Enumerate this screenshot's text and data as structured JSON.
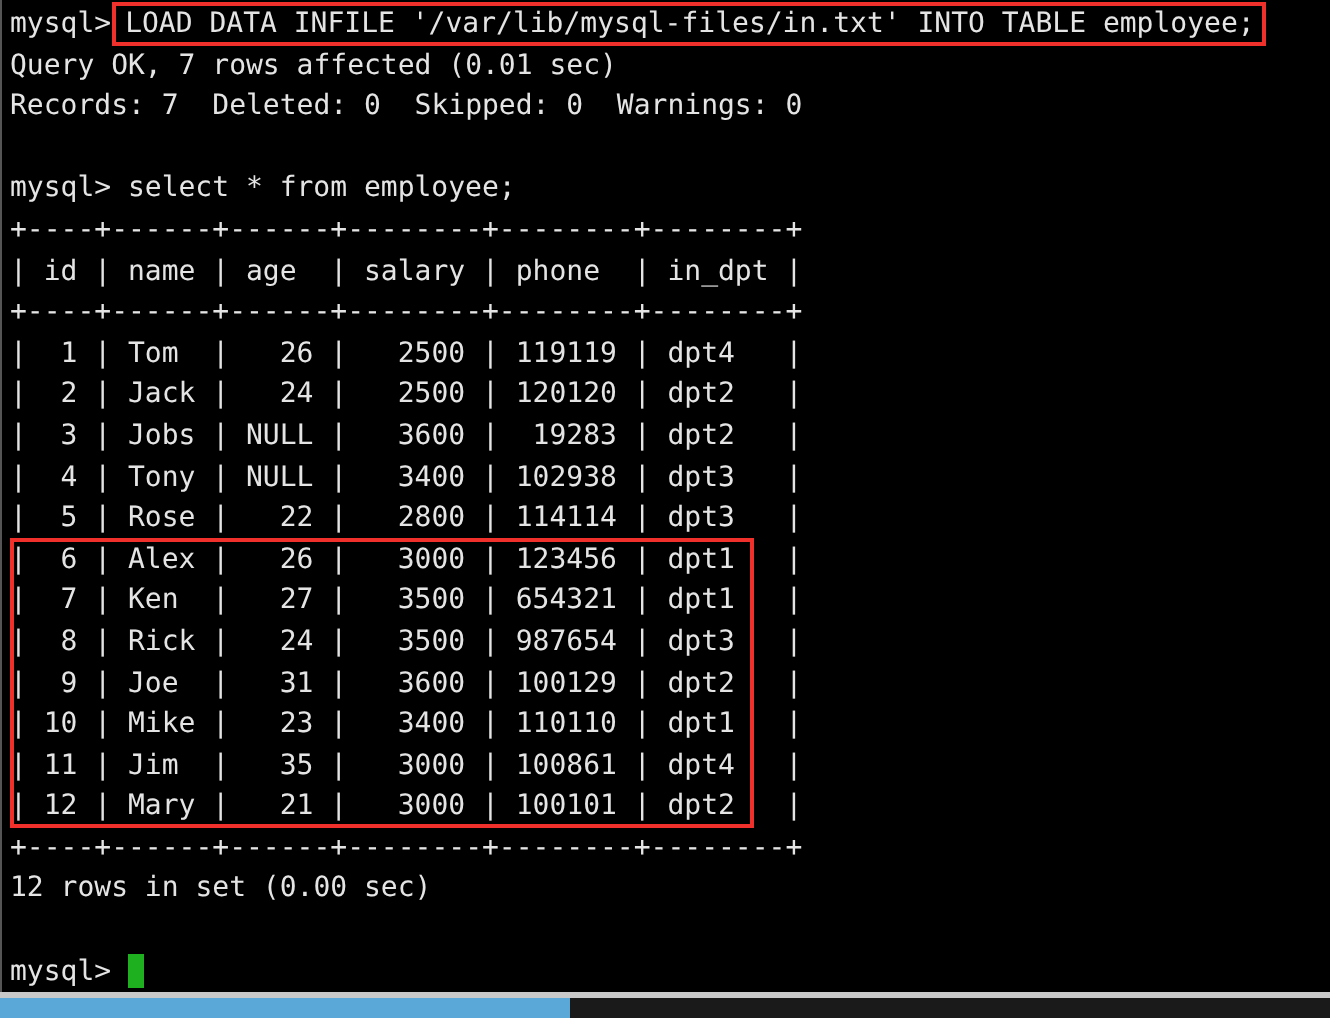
{
  "terminal": {
    "lines": [
      {
        "kind": "command",
        "prompt": "mysql>",
        "text": "LOAD DATA INFILE '/var/lib/mysql-files/in.txt' INTO TABLE employee;",
        "highlighted": true
      },
      {
        "kind": "output",
        "text": "Query OK, 7 rows affected (0.01 sec)"
      },
      {
        "kind": "output",
        "text": "Records: 7  Deleted: 0  Skipped: 0  Warnings: 0"
      },
      {
        "kind": "blank"
      },
      {
        "kind": "command",
        "prompt": "mysql>",
        "text": "select * from employee;",
        "highlighted": false
      },
      {
        "kind": "rule",
        "text": "+----+------+------+--------+--------+--------+"
      },
      {
        "kind": "header",
        "text": "| id | name | age  | salary | phone  | in_dpt |"
      },
      {
        "kind": "rule",
        "text": "+----+------+------+--------+--------+--------+"
      },
      {
        "kind": "row_group",
        "highlighted": false,
        "rows": [
          "|  1 | Tom  |   26 |   2500 | 119119 | dpt4   |",
          "|  2 | Jack |   24 |   2500 | 120120 | dpt2   |",
          "|  3 | Jobs | NULL |   3600 |  19283 | dpt2   |",
          "|  4 | Tony | NULL |   3400 | 102938 | dpt3   |",
          "|  5 | Rose |   22 |   2800 | 114114 | dpt3   |"
        ]
      },
      {
        "kind": "row_group",
        "highlighted": true,
        "rows": [
          "|  6 | Alex |   26 |   3000 | 123456 | dpt1   |",
          "|  7 | Ken  |   27 |   3500 | 654321 | dpt1   |",
          "|  8 | Rick |   24 |   3500 | 987654 | dpt3   |",
          "|  9 | Joe  |   31 |   3600 | 100129 | dpt2   |",
          "| 10 | Mike |   23 |   3400 | 110110 | dpt1   |",
          "| 11 | Jim  |   35 |   3000 | 100861 | dpt4   |",
          "| 12 | Mary |   21 |   3000 | 100101 | dpt2   |"
        ]
      },
      {
        "kind": "rule",
        "text": "+----+------+------+--------+--------+--------+"
      },
      {
        "kind": "output",
        "text": "12 rows in set (0.00 sec)"
      },
      {
        "kind": "blank"
      },
      {
        "kind": "prompt",
        "prompt": "mysql>",
        "cursor": true
      }
    ]
  }
}
